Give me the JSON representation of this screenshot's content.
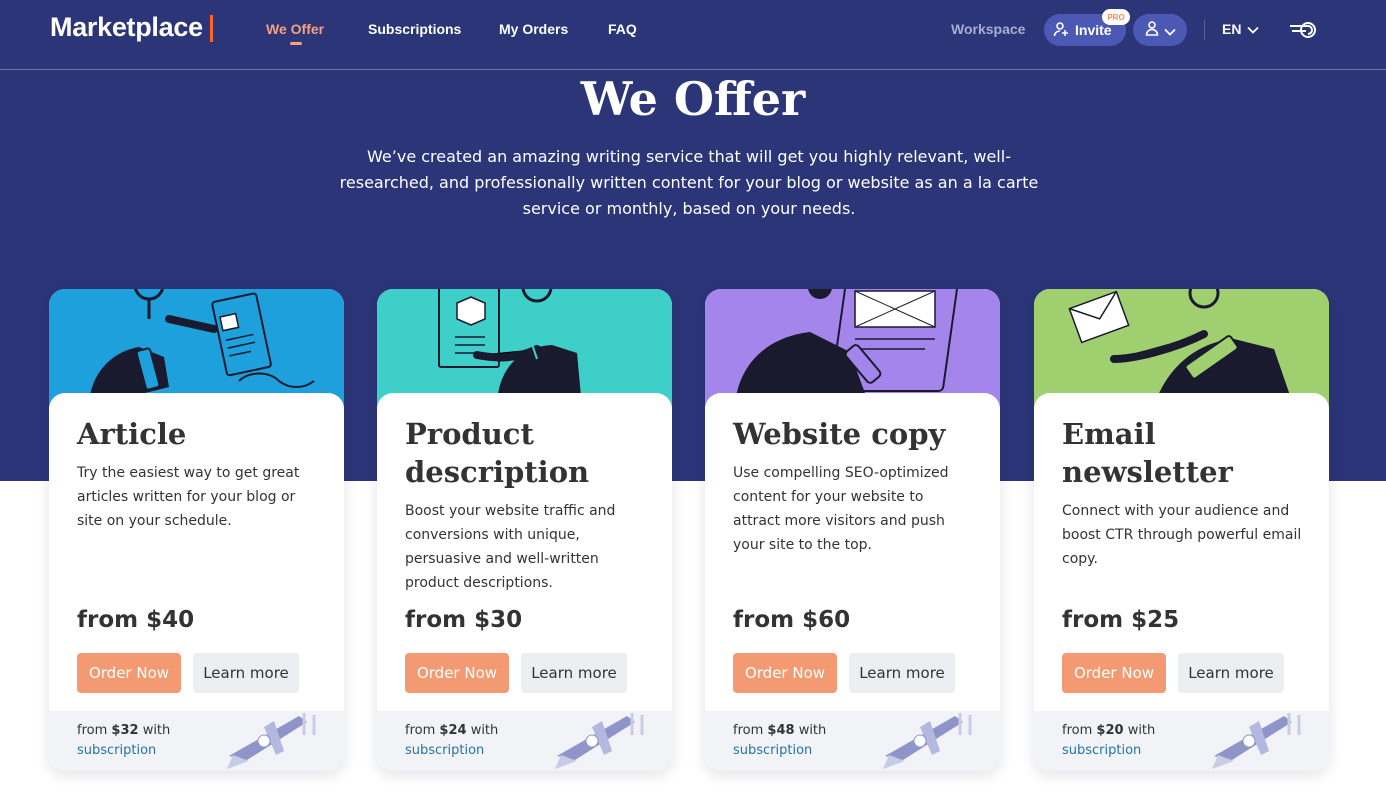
{
  "nav": {
    "logo": "Marketplace",
    "links": [
      "We Offer",
      "Subscriptions",
      "My Orders",
      "FAQ"
    ],
    "workspace": "Workspace",
    "invite": "Invite",
    "pro_badge": "PRO",
    "language": "EN",
    "icons": [
      "invite-user-icon",
      "user-icon",
      "chevron-down-icon",
      "semrush-fire-icon"
    ]
  },
  "hero": {
    "title": "We Offer",
    "subtitle": "We’ve created an amazing writing service that will get you highly relevant, well-researched, and professionally written content for your blog or website as an a la carte service or monthly, based on your needs."
  },
  "cards": [
    {
      "title": "Article",
      "description": "Try the easiest way to get great articles written for your blog or site on your schedule.",
      "price": "from $40",
      "order_label": "Order Now",
      "learn_label": "Learn more",
      "sub_prefix": "from",
      "sub_price": "$32",
      "sub_suffix": "with",
      "sub_link": "subscription",
      "color": "#1ea0dc"
    },
    {
      "title": "Product description",
      "description": "Boost your website traffic and conversions with unique, persuasive and well-written product descriptions.",
      "price": "from $30",
      "order_label": "Order Now",
      "learn_label": "Learn more",
      "sub_prefix": "from",
      "sub_price": "$24",
      "sub_suffix": "with",
      "sub_link": "subscription",
      "color": "#3ecfc9"
    },
    {
      "title": "Website copy",
      "description": "Use compelling SEO-optimized content for your website to attract more visitors and push your site to the top.",
      "price": "from $60",
      "order_label": "Order Now",
      "learn_label": "Learn more",
      "sub_prefix": "from",
      "sub_price": "$48",
      "sub_suffix": "with",
      "sub_link": "subscription",
      "color": "#a385ec"
    },
    {
      "title": "Email newsletter",
      "description": "Connect with your audience and boost CTR through powerful email copy.",
      "price": "from $25",
      "order_label": "Order Now",
      "learn_label": "Learn more",
      "sub_prefix": "from",
      "sub_price": "$20",
      "sub_suffix": "with",
      "sub_link": "subscription",
      "color": "#9fcf6f"
    }
  ],
  "colors": {
    "hero_bg": "#2b3577",
    "accent_orange": "#f39a72",
    "active_link": "#f5a07e",
    "link_blue": "#2672a8"
  }
}
